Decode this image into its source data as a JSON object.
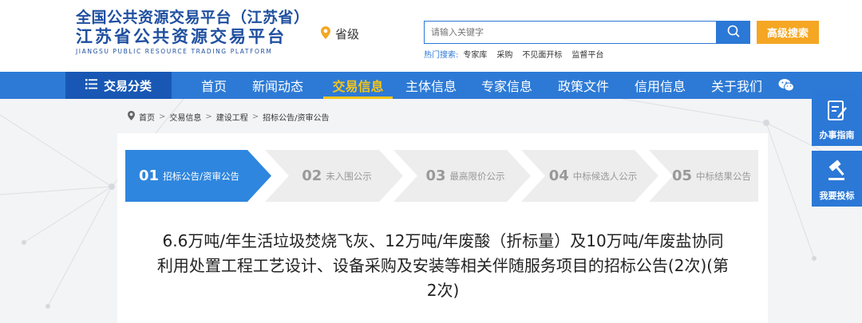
{
  "header": {
    "logo_line1": "全国公共资源交易平台（江苏省）",
    "logo_line2": "江苏省公共资源交易平台",
    "logo_line3": "JIANGSU PUBLIC RESOURCE TRADING PLATFORM",
    "location": "省级",
    "search_placeholder": "请输入关键字",
    "advanced_search": "高级搜索",
    "hot_label": "热门搜索:",
    "hot_items": [
      "专家库",
      "采购",
      "不见面开标",
      "监督平台"
    ]
  },
  "nav": {
    "category": "交易分类",
    "items": [
      "首页",
      "新闻动态",
      "交易信息",
      "主体信息",
      "专家信息",
      "政策文件",
      "信用信息",
      "关于我们"
    ],
    "active_index": 2
  },
  "breadcrumb": [
    "首页",
    "交易信息",
    "建设工程",
    "招标公告/资审公告"
  ],
  "steps": [
    {
      "num": "01",
      "label": "招标公告/资审公告",
      "active": true
    },
    {
      "num": "02",
      "label": "未入围公示",
      "active": false
    },
    {
      "num": "03",
      "label": "最高限价公示",
      "active": false
    },
    {
      "num": "04",
      "label": "中标候选人公示",
      "active": false
    },
    {
      "num": "05",
      "label": "中标结果公告",
      "active": false
    }
  ],
  "title_lines": [
    "6.6万吨/年生活垃圾焚烧飞灰、12万吨/年废酸（折标量）及10万吨/年废盐协同",
    "利用处置工程工艺设计、设备采购及安装等相关伴随服务项目的招标公告(2次)(第",
    "2次)"
  ],
  "float": {
    "guide": "办事指南",
    "bid": "我要投标"
  },
  "colors": {
    "primary_blue": "#2d7ad6",
    "dark_blue": "#1858b4",
    "accent_orange": "#f5a623",
    "active_yellow": "#f5c518",
    "logo_blue": "#1f4fa0"
  }
}
